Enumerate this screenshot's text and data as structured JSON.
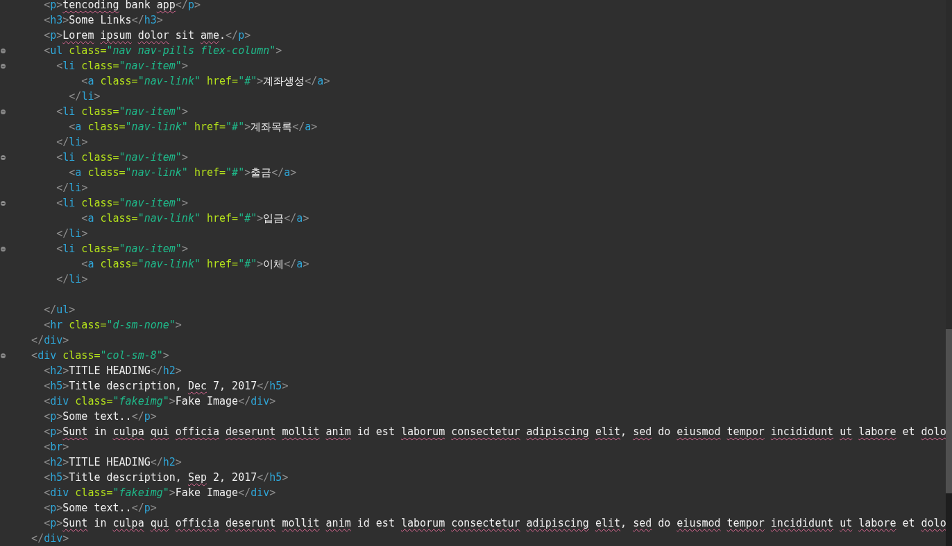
{
  "editor": {
    "lines": [
      {
        "fold": false,
        "tokens": [
          {
            "kind": "punct",
            "text": "      <"
          },
          {
            "kind": "tag",
            "text": "p"
          },
          {
            "kind": "punct",
            "text": ">"
          },
          {
            "kind": "text",
            "text": "tencoding",
            "misspelled": true
          },
          {
            "kind": "text",
            "text": " bank ",
            "misspelled": false
          },
          {
            "kind": "text",
            "text": "app",
            "misspelled": true
          },
          {
            "kind": "punct",
            "text": "</"
          },
          {
            "kind": "tag",
            "text": "p"
          },
          {
            "kind": "punct",
            "text": ">"
          }
        ]
      },
      {
        "fold": false,
        "tokens": [
          {
            "kind": "punct",
            "text": "      <"
          },
          {
            "kind": "tag",
            "text": "h3"
          },
          {
            "kind": "punct",
            "text": ">"
          },
          {
            "kind": "text",
            "text": "Some Links",
            "misspelled": false
          },
          {
            "kind": "punct",
            "text": "</"
          },
          {
            "kind": "tag",
            "text": "h3"
          },
          {
            "kind": "punct",
            "text": ">"
          }
        ]
      },
      {
        "fold": false,
        "tokens": [
          {
            "kind": "punct",
            "text": "      <"
          },
          {
            "kind": "tag",
            "text": "p"
          },
          {
            "kind": "punct",
            "text": ">"
          },
          {
            "kind": "text",
            "text": "Lorem ",
            "misspelled": true
          },
          {
            "kind": "text",
            "text": "ipsum ",
            "misspelled": true
          },
          {
            "kind": "text",
            "text": "dolor",
            "misspelled": true
          },
          {
            "kind": "text",
            "text": " sit ",
            "misspelled": false
          },
          {
            "kind": "text",
            "text": "ame",
            "misspelled": true
          },
          {
            "kind": "text",
            "text": ".",
            "misspelled": false
          },
          {
            "kind": "punct",
            "text": "</"
          },
          {
            "kind": "tag",
            "text": "p"
          },
          {
            "kind": "punct",
            "text": ">"
          }
        ]
      },
      {
        "fold": true,
        "tokens": [
          {
            "kind": "punct",
            "text": "      <"
          },
          {
            "kind": "tag",
            "text": "ul"
          },
          {
            "kind": "attr",
            "text": " class="
          },
          {
            "kind": "string",
            "text": "\"nav nav-pills flex-column\""
          },
          {
            "kind": "punct",
            "text": ">"
          }
        ]
      },
      {
        "fold": true,
        "tokens": [
          {
            "kind": "punct",
            "text": "        <"
          },
          {
            "kind": "tag",
            "text": "li"
          },
          {
            "kind": "attr",
            "text": " class="
          },
          {
            "kind": "string",
            "text": "\"nav-item\""
          },
          {
            "kind": "punct",
            "text": ">"
          }
        ]
      },
      {
        "fold": false,
        "tokens": [
          {
            "kind": "punct",
            "text": "            <"
          },
          {
            "kind": "tag",
            "text": "a"
          },
          {
            "kind": "attr",
            "text": " class="
          },
          {
            "kind": "string",
            "text": "\"nav-link\""
          },
          {
            "kind": "attr",
            "text": " href="
          },
          {
            "kind": "string",
            "text": "\"#\""
          },
          {
            "kind": "punct",
            "text": ">"
          },
          {
            "kind": "text",
            "text": "계좌생성",
            "misspelled": false
          },
          {
            "kind": "punct",
            "text": "</"
          },
          {
            "kind": "tag",
            "text": "a"
          },
          {
            "kind": "punct",
            "text": ">"
          }
        ]
      },
      {
        "fold": false,
        "tokens": [
          {
            "kind": "punct",
            "text": "          </"
          },
          {
            "kind": "tag",
            "text": "li"
          },
          {
            "kind": "punct",
            "text": ">"
          }
        ]
      },
      {
        "fold": true,
        "tokens": [
          {
            "kind": "punct",
            "text": "        <"
          },
          {
            "kind": "tag",
            "text": "li"
          },
          {
            "kind": "attr",
            "text": " class="
          },
          {
            "kind": "string",
            "text": "\"nav-item\""
          },
          {
            "kind": "punct",
            "text": ">"
          }
        ]
      },
      {
        "fold": false,
        "tokens": [
          {
            "kind": "punct",
            "text": "          <"
          },
          {
            "kind": "tag",
            "text": "a"
          },
          {
            "kind": "attr",
            "text": " class="
          },
          {
            "kind": "string",
            "text": "\"nav-link\""
          },
          {
            "kind": "attr",
            "text": " href="
          },
          {
            "kind": "string",
            "text": "\"#\""
          },
          {
            "kind": "punct",
            "text": ">"
          },
          {
            "kind": "text",
            "text": "계좌목록",
            "misspelled": false
          },
          {
            "kind": "punct",
            "text": "</"
          },
          {
            "kind": "tag",
            "text": "a"
          },
          {
            "kind": "punct",
            "text": ">"
          }
        ]
      },
      {
        "fold": false,
        "tokens": [
          {
            "kind": "punct",
            "text": "        </"
          },
          {
            "kind": "tag",
            "text": "li"
          },
          {
            "kind": "punct",
            "text": ">"
          }
        ]
      },
      {
        "fold": true,
        "tokens": [
          {
            "kind": "punct",
            "text": "        <"
          },
          {
            "kind": "tag",
            "text": "li"
          },
          {
            "kind": "attr",
            "text": " class="
          },
          {
            "kind": "string",
            "text": "\"nav-item\""
          },
          {
            "kind": "punct",
            "text": ">"
          }
        ]
      },
      {
        "fold": false,
        "tokens": [
          {
            "kind": "punct",
            "text": "          <"
          },
          {
            "kind": "tag",
            "text": "a"
          },
          {
            "kind": "attr",
            "text": " class="
          },
          {
            "kind": "string",
            "text": "\"nav-link\""
          },
          {
            "kind": "attr",
            "text": " href="
          },
          {
            "kind": "string",
            "text": "\"#\""
          },
          {
            "kind": "punct",
            "text": ">"
          },
          {
            "kind": "text",
            "text": "출금",
            "misspelled": false
          },
          {
            "kind": "punct",
            "text": "</"
          },
          {
            "kind": "tag",
            "text": "a"
          },
          {
            "kind": "punct",
            "text": ">"
          }
        ]
      },
      {
        "fold": false,
        "tokens": [
          {
            "kind": "punct",
            "text": "        </"
          },
          {
            "kind": "tag",
            "text": "li"
          },
          {
            "kind": "punct",
            "text": ">"
          }
        ]
      },
      {
        "fold": true,
        "tokens": [
          {
            "kind": "punct",
            "text": "        <"
          },
          {
            "kind": "tag",
            "text": "li"
          },
          {
            "kind": "attr",
            "text": " class="
          },
          {
            "kind": "string",
            "text": "\"nav-item\""
          },
          {
            "kind": "punct",
            "text": ">"
          }
        ]
      },
      {
        "fold": false,
        "tokens": [
          {
            "kind": "punct",
            "text": "            <"
          },
          {
            "kind": "tag",
            "text": "a"
          },
          {
            "kind": "attr",
            "text": " class="
          },
          {
            "kind": "string",
            "text": "\"nav-link\""
          },
          {
            "kind": "attr",
            "text": " href="
          },
          {
            "kind": "string",
            "text": "\"#\""
          },
          {
            "kind": "punct",
            "text": ">"
          },
          {
            "kind": "text",
            "text": "입금",
            "misspelled": false
          },
          {
            "kind": "punct",
            "text": "</"
          },
          {
            "kind": "tag",
            "text": "a"
          },
          {
            "kind": "punct",
            "text": ">"
          }
        ]
      },
      {
        "fold": false,
        "tokens": [
          {
            "kind": "punct",
            "text": "        </"
          },
          {
            "kind": "tag",
            "text": "li"
          },
          {
            "kind": "punct",
            "text": ">"
          }
        ]
      },
      {
        "fold": true,
        "tokens": [
          {
            "kind": "punct",
            "text": "        <"
          },
          {
            "kind": "tag",
            "text": "li"
          },
          {
            "kind": "attr",
            "text": " class="
          },
          {
            "kind": "string",
            "text": "\"nav-item\""
          },
          {
            "kind": "punct",
            "text": ">"
          }
        ]
      },
      {
        "fold": false,
        "tokens": [
          {
            "kind": "punct",
            "text": "            <"
          },
          {
            "kind": "tag",
            "text": "a"
          },
          {
            "kind": "attr",
            "text": " class="
          },
          {
            "kind": "string",
            "text": "\"nav-link\""
          },
          {
            "kind": "attr",
            "text": " href="
          },
          {
            "kind": "string",
            "text": "\"#\""
          },
          {
            "kind": "punct",
            "text": ">"
          },
          {
            "kind": "text",
            "text": "이체",
            "misspelled": false
          },
          {
            "kind": "punct",
            "text": "</"
          },
          {
            "kind": "tag",
            "text": "a"
          },
          {
            "kind": "punct",
            "text": ">"
          }
        ]
      },
      {
        "fold": false,
        "tokens": [
          {
            "kind": "punct",
            "text": "        </"
          },
          {
            "kind": "tag",
            "text": "li"
          },
          {
            "kind": "punct",
            "text": ">"
          }
        ]
      },
      {
        "fold": false
      },
      {
        "fold": false,
        "tokens": [
          {
            "kind": "punct",
            "text": "      </"
          },
          {
            "kind": "tag",
            "text": "ul"
          },
          {
            "kind": "punct",
            "text": ">"
          }
        ]
      },
      {
        "fold": false,
        "tokens": [
          {
            "kind": "punct",
            "text": "      <"
          },
          {
            "kind": "tag",
            "text": "hr"
          },
          {
            "kind": "attr",
            "text": " class="
          },
          {
            "kind": "string",
            "text": "\"d-sm-none\""
          },
          {
            "kind": "punct",
            "text": ">"
          }
        ]
      },
      {
        "fold": false,
        "tokens": [
          {
            "kind": "punct",
            "text": "    </"
          },
          {
            "kind": "tag",
            "text": "div"
          },
          {
            "kind": "punct",
            "text": ">"
          }
        ]
      },
      {
        "fold": true,
        "tokens": [
          {
            "kind": "punct",
            "text": "    <"
          },
          {
            "kind": "tag",
            "text": "div"
          },
          {
            "kind": "attr",
            "text": " class="
          },
          {
            "kind": "string",
            "text": "\"col-sm-8\""
          },
          {
            "kind": "punct",
            "text": ">"
          }
        ]
      },
      {
        "fold": false,
        "tokens": [
          {
            "kind": "punct",
            "text": "      <"
          },
          {
            "kind": "tag",
            "text": "h2"
          },
          {
            "kind": "punct",
            "text": ">"
          },
          {
            "kind": "text",
            "text": "TITLE HEADING",
            "misspelled": false
          },
          {
            "kind": "punct",
            "text": "</"
          },
          {
            "kind": "tag",
            "text": "h2"
          },
          {
            "kind": "punct",
            "text": ">"
          }
        ]
      },
      {
        "fold": false,
        "tokens": [
          {
            "kind": "punct",
            "text": "      <"
          },
          {
            "kind": "tag",
            "text": "h5"
          },
          {
            "kind": "punct",
            "text": ">"
          },
          {
            "kind": "text",
            "text": "Title description, ",
            "misspelled": false
          },
          {
            "kind": "text",
            "text": "Dec",
            "misspelled": true
          },
          {
            "kind": "text",
            "text": " 7, 2017",
            "misspelled": false
          },
          {
            "kind": "punct",
            "text": "</"
          },
          {
            "kind": "tag",
            "text": "h5"
          },
          {
            "kind": "punct",
            "text": ">"
          }
        ]
      },
      {
        "fold": false,
        "tokens": [
          {
            "kind": "punct",
            "text": "      <"
          },
          {
            "kind": "tag",
            "text": "div"
          },
          {
            "kind": "attr",
            "text": " class="
          },
          {
            "kind": "string",
            "text": "\"fakeimg\""
          },
          {
            "kind": "punct",
            "text": ">"
          },
          {
            "kind": "text",
            "text": "Fake Image",
            "misspelled": false
          },
          {
            "kind": "punct",
            "text": "</"
          },
          {
            "kind": "tag",
            "text": "div"
          },
          {
            "kind": "punct",
            "text": ">"
          }
        ]
      },
      {
        "fold": false,
        "tokens": [
          {
            "kind": "punct",
            "text": "      <"
          },
          {
            "kind": "tag",
            "text": "p"
          },
          {
            "kind": "punct",
            "text": ">"
          },
          {
            "kind": "text",
            "text": "Some text..",
            "misspelled": false
          },
          {
            "kind": "punct",
            "text": "</"
          },
          {
            "kind": "tag",
            "text": "p"
          },
          {
            "kind": "punct",
            "text": ">"
          }
        ]
      },
      {
        "fold": false,
        "tokens": [
          {
            "kind": "punct",
            "text": "      <"
          },
          {
            "kind": "tag",
            "text": "p"
          },
          {
            "kind": "punct",
            "text": ">"
          },
          {
            "kind": "text",
            "text": "Sunt",
            "misspelled": true
          },
          {
            "kind": "text",
            "text": " in ",
            "misspelled": false
          },
          {
            "kind": "text",
            "text": "culpa ",
            "misspelled": true
          },
          {
            "kind": "text",
            "text": "qui ",
            "misspelled": true
          },
          {
            "kind": "text",
            "text": "officia ",
            "misspelled": true
          },
          {
            "kind": "text",
            "text": "deserunt ",
            "misspelled": true
          },
          {
            "kind": "text",
            "text": "mollit ",
            "misspelled": true
          },
          {
            "kind": "text",
            "text": "anim",
            "misspelled": true
          },
          {
            "kind": "text",
            "text": " id est ",
            "misspelled": false
          },
          {
            "kind": "text",
            "text": "laborum ",
            "misspelled": true
          },
          {
            "kind": "text",
            "text": "consectetur ",
            "misspelled": true
          },
          {
            "kind": "text",
            "text": "adipiscing ",
            "misspelled": true
          },
          {
            "kind": "text",
            "text": "elit",
            "misspelled": true
          },
          {
            "kind": "text",
            "text": ", ",
            "misspelled": false
          },
          {
            "kind": "text",
            "text": "sed",
            "misspelled": true
          },
          {
            "kind": "text",
            "text": " do ",
            "misspelled": false
          },
          {
            "kind": "text",
            "text": "eiusmod ",
            "misspelled": true
          },
          {
            "kind": "text",
            "text": "tempor ",
            "misspelled": true
          },
          {
            "kind": "text",
            "text": "incididunt ",
            "misspelled": true
          },
          {
            "kind": "text",
            "text": "ut ",
            "misspelled": true
          },
          {
            "kind": "text",
            "text": "labore",
            "misspelled": true
          },
          {
            "kind": "text",
            "text": " et ",
            "misspelled": false
          },
          {
            "kind": "text",
            "text": "dolo",
            "misspelled": true
          }
        ]
      },
      {
        "fold": false,
        "tokens": [
          {
            "kind": "punct",
            "text": "      <"
          },
          {
            "kind": "tag",
            "text": "br"
          },
          {
            "kind": "punct",
            "text": ">"
          }
        ]
      },
      {
        "fold": false,
        "tokens": [
          {
            "kind": "punct",
            "text": "      <"
          },
          {
            "kind": "tag",
            "text": "h2"
          },
          {
            "kind": "punct",
            "text": ">"
          },
          {
            "kind": "text",
            "text": "TITLE HEADING",
            "misspelled": false
          },
          {
            "kind": "punct",
            "text": "</"
          },
          {
            "kind": "tag",
            "text": "h2"
          },
          {
            "kind": "punct",
            "text": ">"
          }
        ]
      },
      {
        "fold": false,
        "tokens": [
          {
            "kind": "punct",
            "text": "      <"
          },
          {
            "kind": "tag",
            "text": "h5"
          },
          {
            "kind": "punct",
            "text": ">"
          },
          {
            "kind": "text",
            "text": "Title description, ",
            "misspelled": false
          },
          {
            "kind": "text",
            "text": "Sep",
            "misspelled": true
          },
          {
            "kind": "text",
            "text": " 2, 2017",
            "misspelled": false
          },
          {
            "kind": "punct",
            "text": "</"
          },
          {
            "kind": "tag",
            "text": "h5"
          },
          {
            "kind": "punct",
            "text": ">"
          }
        ]
      },
      {
        "fold": false,
        "tokens": [
          {
            "kind": "punct",
            "text": "      <"
          },
          {
            "kind": "tag",
            "text": "div"
          },
          {
            "kind": "attr",
            "text": " class="
          },
          {
            "kind": "string",
            "text": "\"fakeimg\""
          },
          {
            "kind": "punct",
            "text": ">"
          },
          {
            "kind": "text",
            "text": "Fake Image",
            "misspelled": false
          },
          {
            "kind": "punct",
            "text": "</"
          },
          {
            "kind": "tag",
            "text": "div"
          },
          {
            "kind": "punct",
            "text": ">"
          }
        ]
      },
      {
        "fold": false,
        "tokens": [
          {
            "kind": "punct",
            "text": "      <"
          },
          {
            "kind": "tag",
            "text": "p"
          },
          {
            "kind": "punct",
            "text": ">"
          },
          {
            "kind": "text",
            "text": "Some text..",
            "misspelled": false
          },
          {
            "kind": "punct",
            "text": "</"
          },
          {
            "kind": "tag",
            "text": "p"
          },
          {
            "kind": "punct",
            "text": ">"
          }
        ]
      },
      {
        "fold": false,
        "tokens": [
          {
            "kind": "punct",
            "text": "      <"
          },
          {
            "kind": "tag",
            "text": "p"
          },
          {
            "kind": "punct",
            "text": ">"
          },
          {
            "kind": "text",
            "text": "Sunt",
            "misspelled": true
          },
          {
            "kind": "text",
            "text": " in ",
            "misspelled": false
          },
          {
            "kind": "text",
            "text": "culpa ",
            "misspelled": true
          },
          {
            "kind": "text",
            "text": "qui ",
            "misspelled": true
          },
          {
            "kind": "text",
            "text": "officia ",
            "misspelled": true
          },
          {
            "kind": "text",
            "text": "deserunt ",
            "misspelled": true
          },
          {
            "kind": "text",
            "text": "mollit ",
            "misspelled": true
          },
          {
            "kind": "text",
            "text": "anim",
            "misspelled": true
          },
          {
            "kind": "text",
            "text": " id est ",
            "misspelled": false
          },
          {
            "kind": "text",
            "text": "laborum ",
            "misspelled": true
          },
          {
            "kind": "text",
            "text": "consectetur ",
            "misspelled": true
          },
          {
            "kind": "text",
            "text": "adipiscing ",
            "misspelled": true
          },
          {
            "kind": "text",
            "text": "elit",
            "misspelled": true
          },
          {
            "kind": "text",
            "text": ", ",
            "misspelled": false
          },
          {
            "kind": "text",
            "text": "sed",
            "misspelled": true
          },
          {
            "kind": "text",
            "text": " do ",
            "misspelled": false
          },
          {
            "kind": "text",
            "text": "eiusmod ",
            "misspelled": true
          },
          {
            "kind": "text",
            "text": "tempor ",
            "misspelled": true
          },
          {
            "kind": "text",
            "text": "incididunt ",
            "misspelled": true
          },
          {
            "kind": "text",
            "text": "ut ",
            "misspelled": true
          },
          {
            "kind": "text",
            "text": "labore",
            "misspelled": true
          },
          {
            "kind": "text",
            "text": " et ",
            "misspelled": false
          },
          {
            "kind": "text",
            "text": "dolo",
            "misspelled": true
          }
        ]
      },
      {
        "fold": false,
        "tokens": [
          {
            "kind": "punct",
            "text": "    </"
          },
          {
            "kind": "tag",
            "text": "div"
          },
          {
            "kind": "punct",
            "text": ">"
          }
        ]
      }
    ]
  }
}
